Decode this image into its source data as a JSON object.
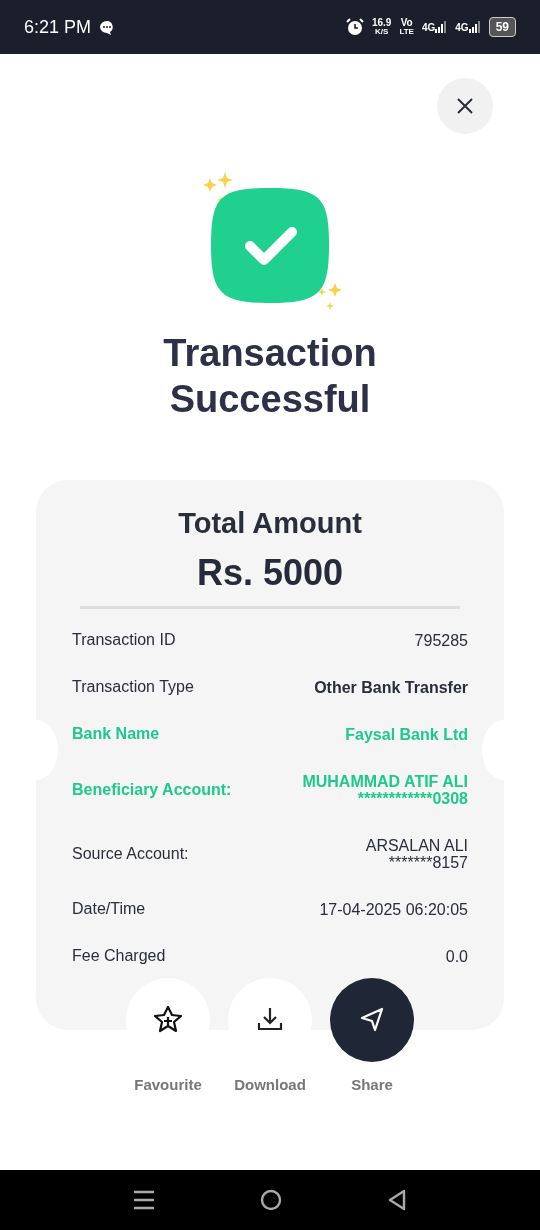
{
  "status_bar": {
    "time": "6:21 PM",
    "speed": "16.9",
    "speed_unit": "K/S",
    "volte_top": "Vo",
    "volte_bottom": "LTE",
    "network_1": "4G",
    "network_2": "4G",
    "battery": "59"
  },
  "title": "Transaction Successful",
  "receipt": {
    "heading": "Total Amount",
    "amount": "Rs. 5000",
    "rows": [
      {
        "kind": "plain",
        "label": "Transaction ID",
        "value": [
          "795285"
        ]
      },
      {
        "kind": "bold",
        "label": "Transaction Type",
        "value": [
          "Other Bank Transfer"
        ]
      },
      {
        "kind": "highlight",
        "label": "Bank Name",
        "value": [
          "Faysal Bank Ltd"
        ]
      },
      {
        "kind": "highlight",
        "label": "Beneficiary Account:",
        "value": [
          "MUHAMMAD ATIF ALI",
          "************0308"
        ]
      },
      {
        "kind": "plain",
        "label": "Source Account:",
        "value": [
          "ARSALAN ALI",
          "*******8157"
        ]
      },
      {
        "kind": "plain",
        "label": "Date/Time",
        "value": [
          "17-04-2025 06:20:05"
        ]
      },
      {
        "kind": "plain",
        "label": "Fee Charged",
        "value": [
          "0.0"
        ]
      }
    ]
  },
  "actions": [
    {
      "kind": "favourite",
      "label": "Favourite",
      "primary": false
    },
    {
      "kind": "download",
      "label": "Download",
      "primary": false
    },
    {
      "kind": "share",
      "label": "Share",
      "primary": true
    }
  ]
}
